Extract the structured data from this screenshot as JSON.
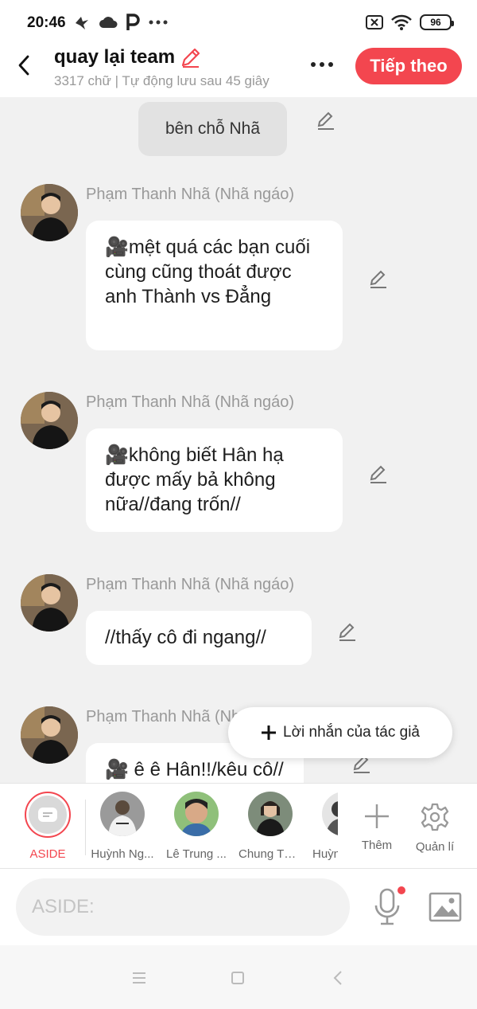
{
  "status_bar": {
    "time": "20:46",
    "battery": "96"
  },
  "header": {
    "title": "quay lại team",
    "subtitle": "3317 chữ | Tự động lưu sau 45 giây",
    "next_label": "Tiếp theo"
  },
  "chat": {
    "center_message": "bên chỗ Nhã",
    "messages": [
      {
        "sender": "Phạm Thanh Nhã (Nhã ngáo)",
        "text": "🎥mệt quá các bạn cuối cùng cũng thoát được anh Thành vs Đẳng"
      },
      {
        "sender": "Phạm Thanh Nhã (Nhã ngáo)",
        "text": "🎥không biết Hân hạ được mấy bả không nữa//đang trốn//"
      },
      {
        "sender": "Phạm Thanh Nhã (Nhã ngáo)",
        "text": "//thấy cô đi ngang//"
      },
      {
        "sender": "Phạm Thanh Nhã (Nhã ngáo)",
        "text": "🎥 ê ê Hân!!/kêu cô//"
      }
    ],
    "floating_note_label": "Lời nhắn của tác giả"
  },
  "characters": {
    "aside_label": "ASIDE",
    "items": [
      {
        "label": "Huỳnh Ng..."
      },
      {
        "label": "Lê Trung ..."
      },
      {
        "label": "Chung Thị..."
      },
      {
        "label": "Huỳn"
      }
    ],
    "add_label": "Thêm",
    "manage_label": "Quản lí"
  },
  "input": {
    "placeholder": "ASIDE:"
  },
  "colors": {
    "accent": "#f3464f",
    "bubble": "#ffffff",
    "background": "#f1f1f1"
  }
}
